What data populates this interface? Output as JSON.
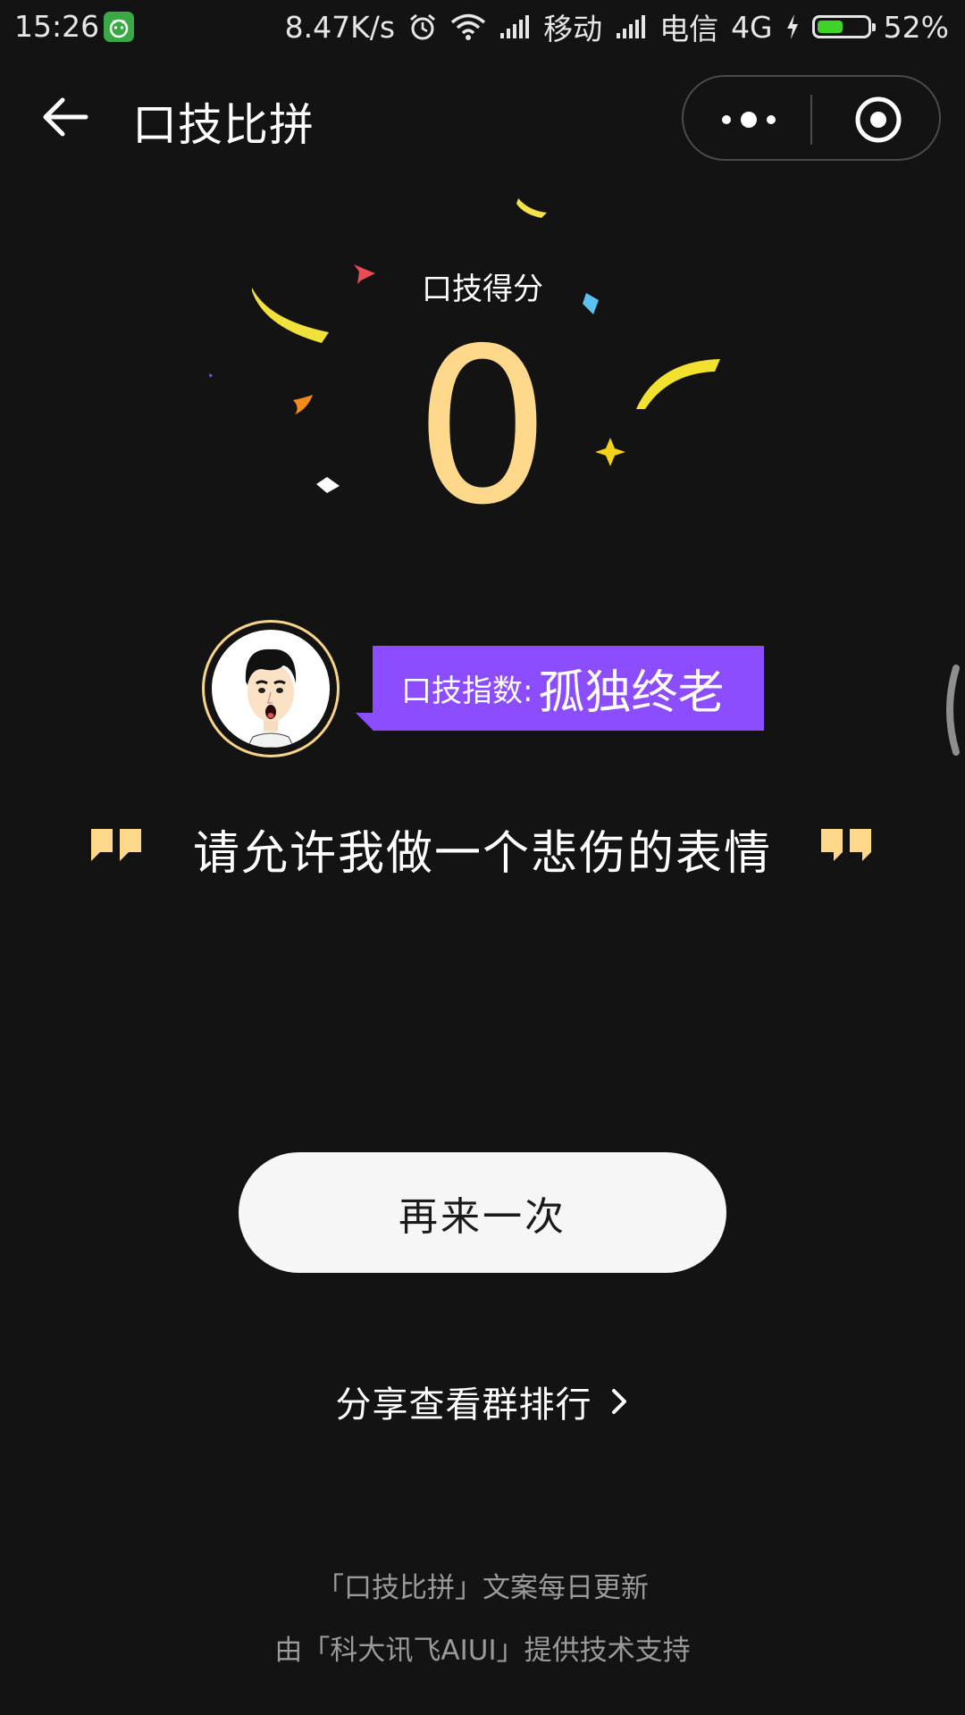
{
  "status_bar": {
    "time": "15:26",
    "net_speed": "8.47K/s",
    "carrier1": "移动",
    "carrier2": "电信",
    "network_type": "4G",
    "battery_percent_text": "52%",
    "battery_level": 0.52,
    "icons": [
      "app-notification-icon",
      "alarm-icon",
      "wifi-icon",
      "signal-icon",
      "signal-icon",
      "charging-icon",
      "battery-icon"
    ]
  },
  "nav": {
    "title": "口技比拼",
    "icons": [
      "back-arrow-icon",
      "more-dots-icon",
      "close-target-icon"
    ]
  },
  "score": {
    "label": "口技得分",
    "value": "0",
    "color": "#ffd98b"
  },
  "badge": {
    "label": "口技指数:",
    "value": "孤独终老",
    "color": "#8b4dff"
  },
  "quote": {
    "text": "请允许我做一个悲伤的表情"
  },
  "actions": {
    "retry_label": "再来一次",
    "share_label": "分享查看群排行"
  },
  "footer": {
    "line1": "「口技比拼」文案每日更新",
    "line2": "由「科大讯飞AIUI」提供技术支持"
  }
}
